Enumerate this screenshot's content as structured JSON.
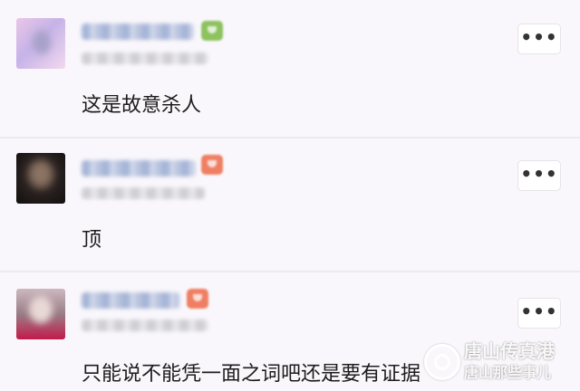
{
  "comments": [
    {
      "text": "这是故意杀人"
    },
    {
      "text": "顶"
    },
    {
      "text": "只能说不能凭一面之词吧还是要有证据"
    }
  ],
  "more_button_label": "•••",
  "watermark": {
    "line1": "唐山传真港",
    "line2": "唐山那些事儿"
  }
}
